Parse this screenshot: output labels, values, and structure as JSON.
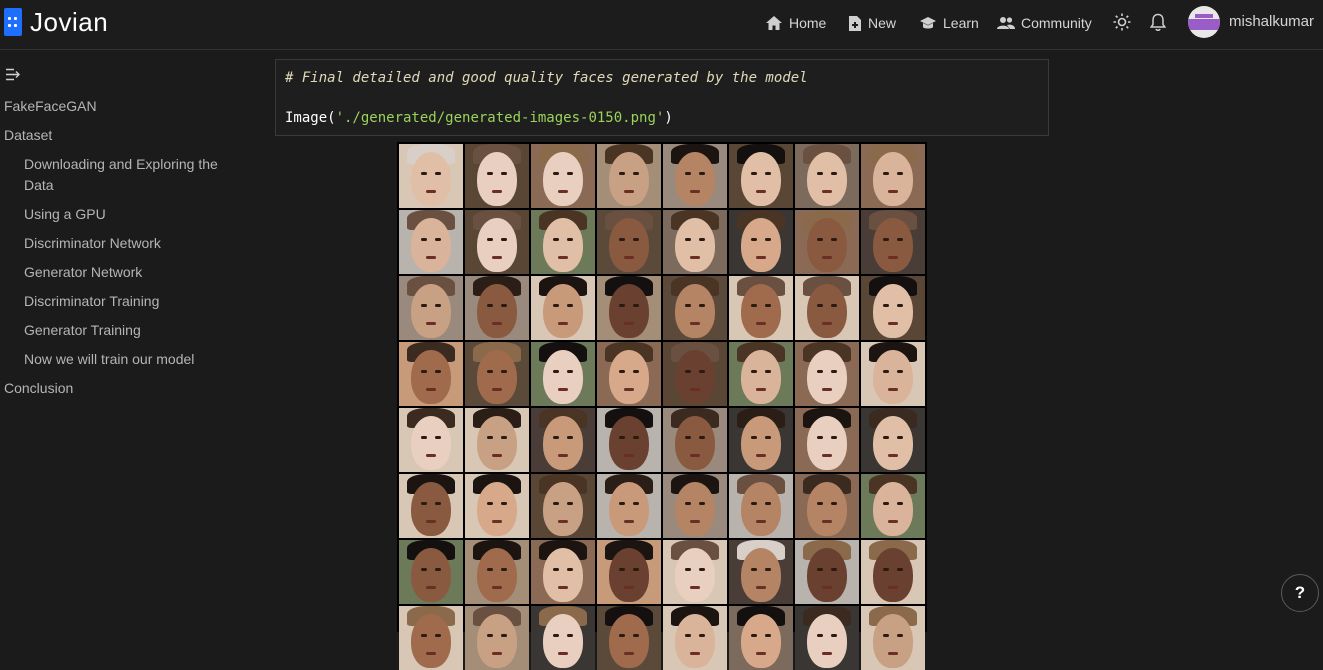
{
  "header": {
    "brand": "Jovian",
    "nav": [
      {
        "label": "Home",
        "icon": "home-icon"
      },
      {
        "label": "New",
        "icon": "new-file-icon"
      },
      {
        "label": "Learn",
        "icon": "graduation-cap-icon"
      },
      {
        "label": "Community",
        "icon": "people-icon"
      }
    ],
    "username": "mishalkumar"
  },
  "sidebar": {
    "items": [
      {
        "label": "FakeFaceGAN",
        "level": 1
      },
      {
        "label": "Dataset",
        "level": 1
      },
      {
        "label": "Downloading and Exploring the Data",
        "level": 2
      },
      {
        "label": "Using a GPU",
        "level": 2
      },
      {
        "label": "Discriminator Network",
        "level": 2
      },
      {
        "label": "Generator Network",
        "level": 2
      },
      {
        "label": "Discriminator Training",
        "level": 2
      },
      {
        "label": "Generator Training",
        "level": 2
      },
      {
        "label": "Now we will train our model",
        "level": 2
      },
      {
        "label": "Conclusion",
        "level": 1
      }
    ]
  },
  "cell": {
    "comment": "# Final detailed and good quality faces generated by the model",
    "code_fn": "Image(",
    "code_str": "'./generated/generated-images-0150.png'",
    "code_close": ")"
  },
  "help": {
    "label": "?"
  },
  "colors": {
    "accent": "#1f6fff",
    "avatar": "#9a5cc7",
    "string": "#9bd35a",
    "comment": "#e0d9b8"
  }
}
